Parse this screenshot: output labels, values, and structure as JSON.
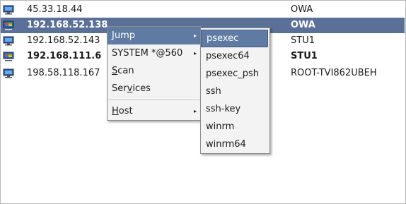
{
  "rows": [
    {
      "host": "45.33.18.44",
      "name": "OWA",
      "icon": "windows-monitor-icon"
    },
    {
      "host": "192.168.52.138",
      "name": "OWA",
      "icon": "windows-monitor-icon",
      "selected": true
    },
    {
      "host": "192.168.52.143",
      "name": "STU1",
      "icon": "windows-monitor-icon"
    },
    {
      "host": "192.168.111.6",
      "name": "STU1",
      "icon": "windows-monitor-icon"
    },
    {
      "host": "198.58.118.167",
      "name": "ROOT-TVI862UBEH",
      "icon": "windows-monitor-icon"
    }
  ],
  "context_menu": {
    "items": [
      {
        "label": "Jump",
        "accel": "J",
        "rest": "ump"
      },
      {
        "label": "SYSTEM *@560"
      },
      {
        "label": "Scan",
        "accel": "S",
        "rest": "can"
      },
      {
        "label": "Services",
        "pre": "Ser",
        "accel": "v",
        "rest": "ices"
      },
      {
        "label": "Host",
        "accel": "H",
        "rest": "ost"
      }
    ]
  },
  "jump_submenu": {
    "items": [
      "psexec",
      "psexec64",
      "psexec_psh",
      "ssh",
      "ssh-key",
      "winrm",
      "winrm64"
    ]
  },
  "colors": {
    "selection": "#5a7096",
    "menu_highlight": "#5f7ba4"
  }
}
